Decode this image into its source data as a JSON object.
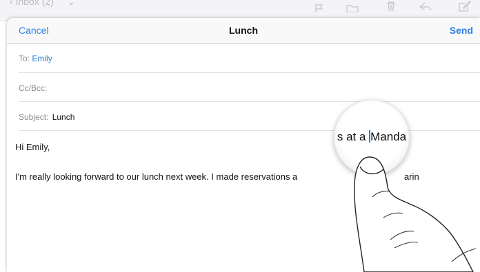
{
  "background_toolbar": {
    "back_label": "Inbox (2)",
    "icons": [
      "flag-icon",
      "folder-icon",
      "trash-icon",
      "reply-icon",
      "compose-icon"
    ]
  },
  "compose": {
    "nav": {
      "cancel_label": "Cancel",
      "title": "Lunch",
      "send_label": "Send"
    },
    "to": {
      "label": "To:",
      "value": "Emily"
    },
    "cc": {
      "label": "Cc/Bcc:"
    },
    "subject": {
      "label": "Subject:",
      "value": "Lunch"
    },
    "body": {
      "greeting": "Hi Emily,",
      "line1_visible": "I'm really looking forward to our lunch next week. I made reservations a",
      "line1_tail_visible": "arin"
    }
  },
  "magnifier": {
    "text_before": "s at a ",
    "text_after": "Manda"
  },
  "colors": {
    "accent": "#2f7fe0",
    "label_gray": "#8e8e93",
    "separator": "#e1e1e5"
  }
}
